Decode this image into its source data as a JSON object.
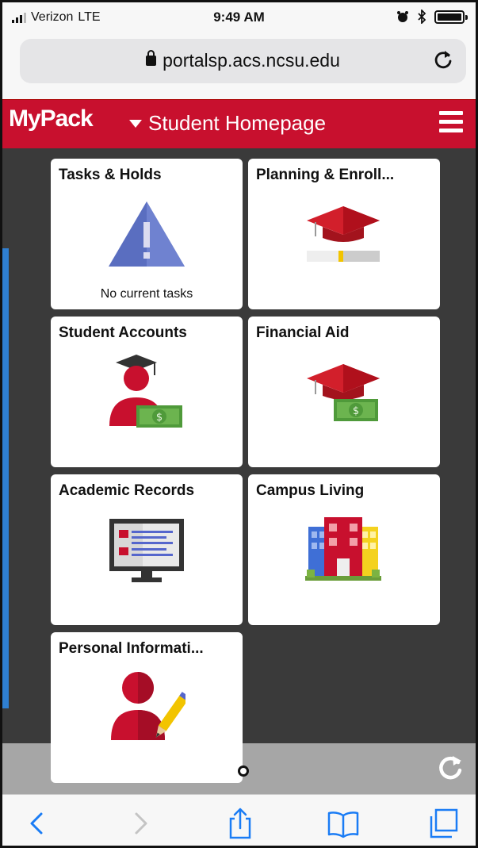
{
  "status_bar": {
    "carrier": "Verizon",
    "network": "LTE",
    "time": "9:49 AM"
  },
  "browser": {
    "url": "portalsp.acs.ncsu.edu"
  },
  "header": {
    "logo": "MyPack",
    "page_title": "Student Homepage"
  },
  "tiles": [
    {
      "title": "Tasks & Holds",
      "subtitle": "No current tasks",
      "icon": "warning-triangle-icon"
    },
    {
      "title": "Planning & Enroll...",
      "icon": "graduation-cap-progress-icon"
    },
    {
      "title": "Student Accounts",
      "icon": "student-money-icon"
    },
    {
      "title": "Financial Aid",
      "icon": "graduation-cap-money-icon"
    },
    {
      "title": "Academic Records",
      "icon": "monitor-records-icon"
    },
    {
      "title": "Campus Living",
      "icon": "buildings-icon"
    },
    {
      "title": "Personal Informati...",
      "icon": "person-pencil-icon"
    }
  ],
  "colors": {
    "brand_red": "#c8102e",
    "content_bg": "#3a3a3a",
    "ios_blue": "#1a7cf5"
  }
}
